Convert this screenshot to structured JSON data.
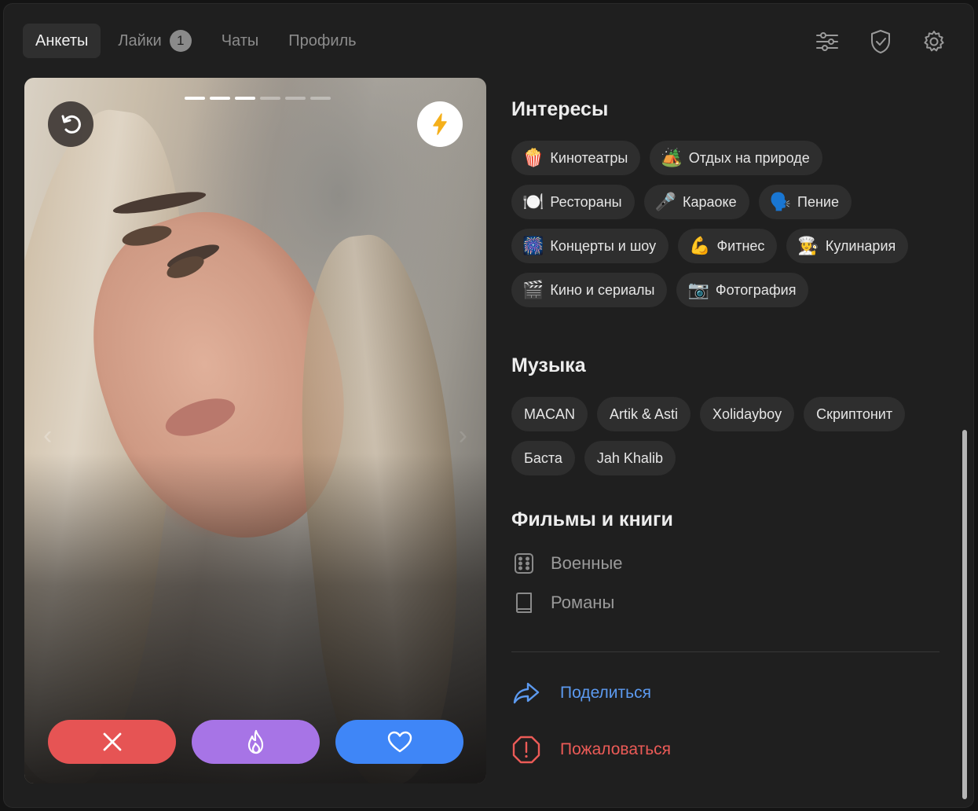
{
  "tabs": [
    {
      "label": "Анкеты",
      "active": true
    },
    {
      "label": "Лайки",
      "badge": "1"
    },
    {
      "label": "Чаты"
    },
    {
      "label": "Профиль"
    }
  ],
  "header_icons": [
    "filter-sliders-icon",
    "shield-check-icon",
    "gear-icon"
  ],
  "photo": {
    "total": 6,
    "current": 3
  },
  "actions": [
    "close-icon",
    "flame-icon",
    "heart-icon"
  ],
  "colors": {
    "dislike": "#e65454",
    "superlike": "#a774e6",
    "like": "#3f86f7",
    "share": "#5c9af0",
    "report": "#ec5b57"
  },
  "interests": {
    "title": "Интересы",
    "items": [
      {
        "emoji": "🍿",
        "label": "Кинотеатры"
      },
      {
        "emoji": "🏕️",
        "label": "Отдых на природе"
      },
      {
        "emoji": "🍽️",
        "label": "Рестораны"
      },
      {
        "emoji": "🎤",
        "label": "Караоке"
      },
      {
        "emoji": "🗣️",
        "label": "Пение"
      },
      {
        "emoji": "🎆",
        "label": "Концерты и шоу"
      },
      {
        "emoji": "💪",
        "label": "Фитнес"
      },
      {
        "emoji": "👩‍🍳",
        "label": "Кулинария"
      },
      {
        "emoji": "🎬",
        "label": "Кино и сериалы"
      },
      {
        "emoji": "📷",
        "label": "Фотография"
      }
    ]
  },
  "music": {
    "title": "Музыка",
    "items": [
      "MACAN",
      "Artik & Asti",
      "Xolidayboy",
      "Скриптонит",
      "Баста",
      "Jah Khalib"
    ]
  },
  "films": {
    "title": "Фильмы и книги",
    "items": [
      {
        "icon": "dice-icon",
        "label": "Военные"
      },
      {
        "icon": "book-icon",
        "label": "Романы"
      }
    ]
  },
  "links": {
    "share": "Поделиться",
    "report": "Пожаловаться"
  }
}
